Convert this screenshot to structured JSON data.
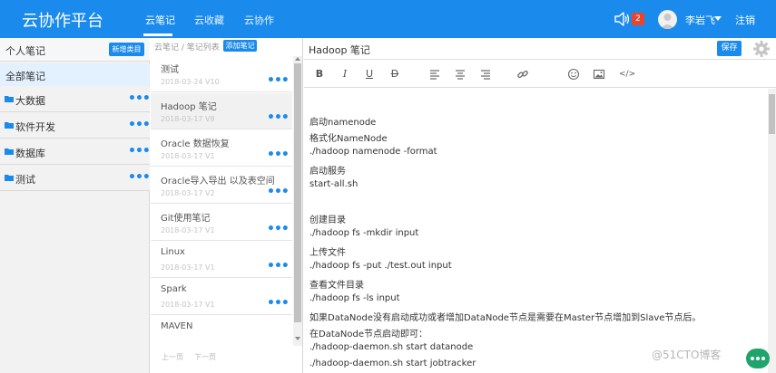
{
  "header": {
    "brand": "云协作平台",
    "tabs": [
      "云笔记",
      "云收藏",
      "云协作"
    ],
    "active_tab": "云笔记",
    "notification_count": "2",
    "username": "李岩飞",
    "logout": "注销",
    "accent": "#1a8bec"
  },
  "categories": {
    "title": "个人笔记",
    "new_button": "新增类目",
    "all_notes": "全部笔记",
    "items": [
      {
        "label": "大数据",
        "more": "•••"
      },
      {
        "label": "软件开发",
        "more": "•••"
      },
      {
        "label": "数据库",
        "more": "•••"
      },
      {
        "label": "测试",
        "more": "•••"
      }
    ]
  },
  "notes": {
    "breadcrumb": "云笔记 / 笔记列表",
    "add_button": "添加笔记",
    "items": [
      {
        "title": "测试",
        "meta": "2018-03-24 V10"
      },
      {
        "title": "Hadoop 笔记",
        "meta": "2018-03-17 V8"
      },
      {
        "title": "Oracle 数据恢复",
        "meta": "2018-03-17 V1"
      },
      {
        "title": "Oracle导入导出 以及表空间",
        "meta": "2018-03-17 V2"
      },
      {
        "title": "Git使用笔记",
        "meta": "2018-03-17 V1"
      },
      {
        "title": "Linux",
        "meta": "2018-03-17 V1"
      },
      {
        "title": "Spark",
        "meta": "2018-03-17 V1"
      },
      {
        "title": "MAVEN",
        "meta": ""
      }
    ],
    "more": "•••",
    "prev": "上一页",
    "next": "下一页"
  },
  "editor": {
    "title": "Hadoop 笔记",
    "save": "保存",
    "toolbar_icons": [
      "bold-icon",
      "italic-icon",
      "underline-icon",
      "strikethrough-icon",
      "align-left-icon",
      "align-center-icon",
      "align-right-icon",
      "link-icon",
      "emoji-icon",
      "image-icon",
      "code-icon"
    ],
    "lines": [
      "",
      "启动namenode",
      "格式化NameNode",
      "./hadoop namenode -format",
      "启动服务",
      "start-all.sh",
      "",
      "创建目录",
      "./hadoop fs -mkdir input",
      "上传文件",
      "./hadoop fs -put ./test.out input",
      "查看文件目录",
      "./hadoop fs -ls input",
      "如果DataNode没有启动成功或者增加DataNode节点是需要在Master节点增加到Slave节点后。",
      "在DataNode节点启动即可：",
      "./hadoop-daemon.sh  start datanode",
      "./hadoop-daemon.sh  start jobtracker"
    ]
  },
  "watermark": "@51CTO博客"
}
